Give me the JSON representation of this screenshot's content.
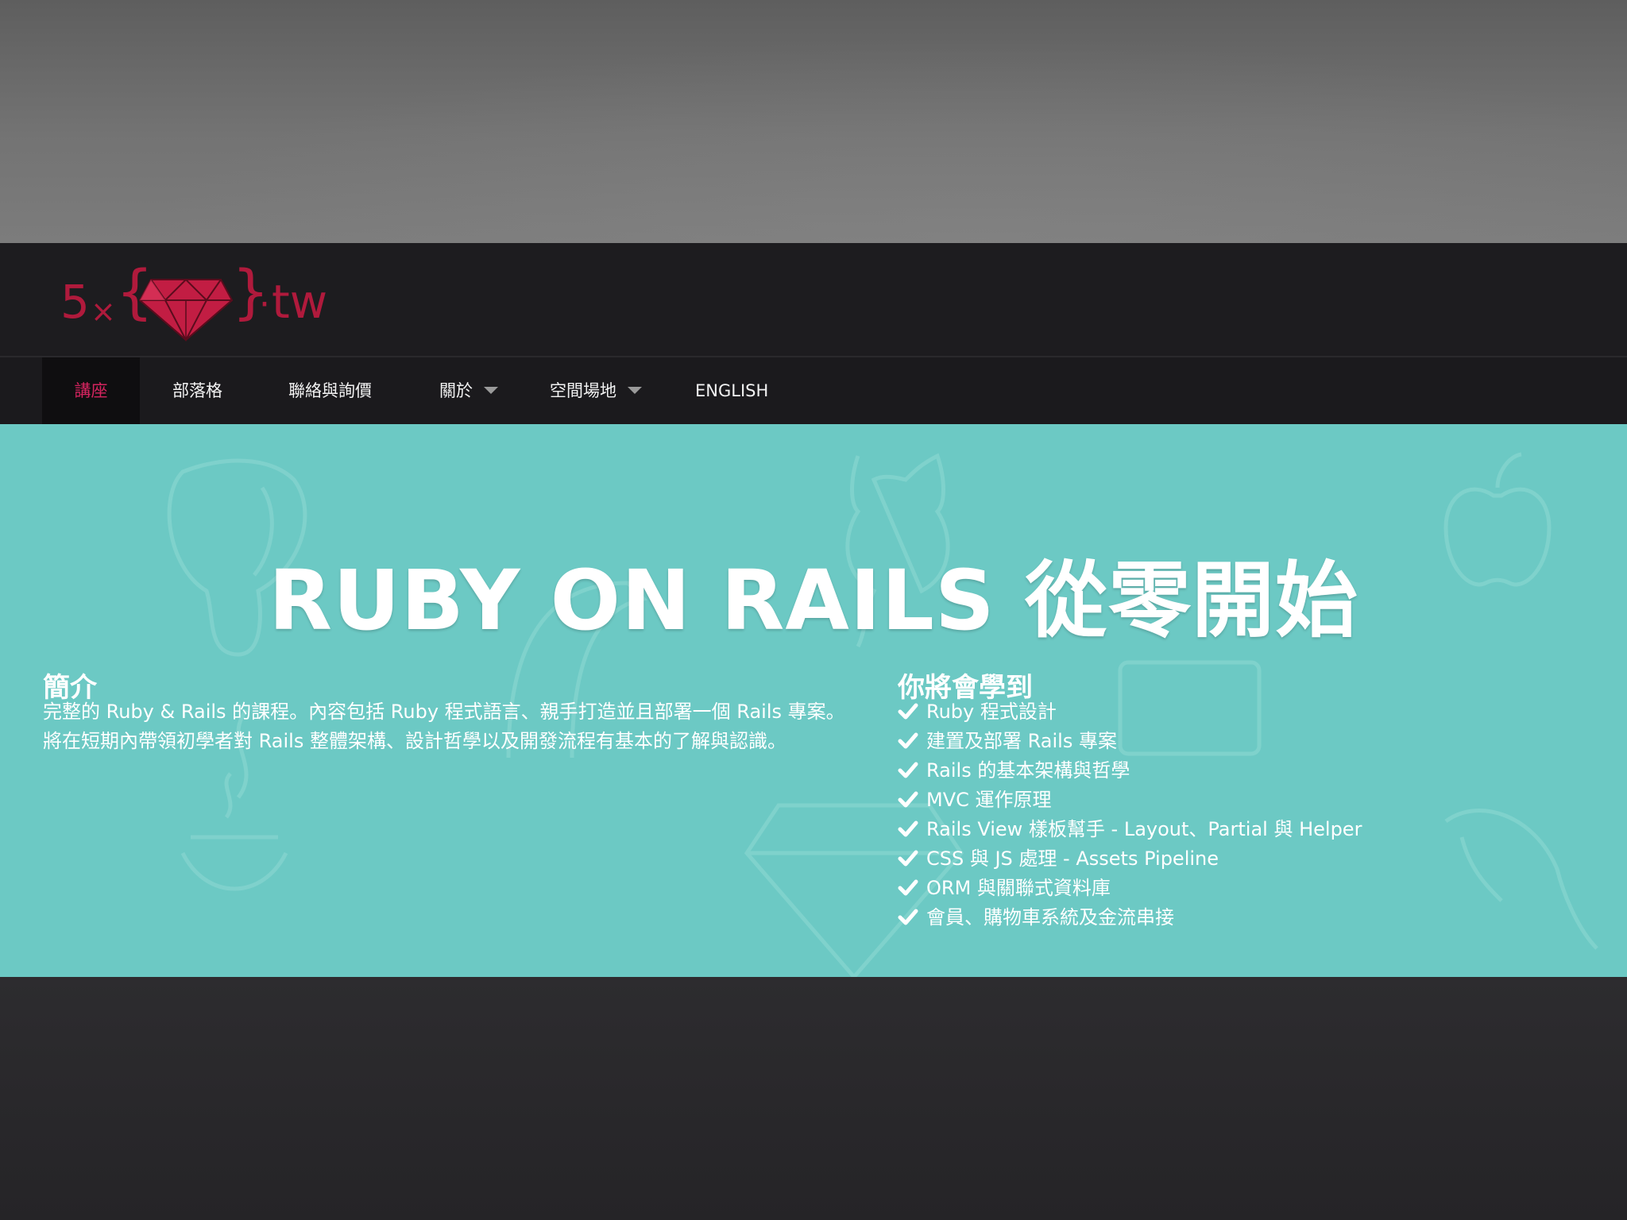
{
  "brand": {
    "logo_parts": [
      "5",
      "×",
      "{",
      "}",
      "·",
      "tw"
    ],
    "logo_color": "#b01a3c"
  },
  "nav": {
    "items": [
      {
        "label": "講座",
        "active": true
      },
      {
        "label": "部落格"
      },
      {
        "label": "聯絡與詢價"
      },
      {
        "label": "關於",
        "has_dropdown": true
      },
      {
        "label": "空間場地",
        "has_dropdown": true
      },
      {
        "label": "ENGLISH"
      }
    ],
    "active_color": "#d4245f"
  },
  "hero": {
    "title": "RUBY ON RAILS 從零開始",
    "background_color": "#6cc9c4",
    "intro": {
      "heading": "簡介",
      "text": "完整的 Ruby & Rails 的課程。內容包括 Ruby 程式語言、親手打造並且部署一個 Rails 專案。將在短期內帶領初學者對 Rails 整體架構、設計哲學以及開發流程有基本的了解與認識。"
    },
    "learn": {
      "heading": "你將會學到",
      "check_icon": "check-icon",
      "items": [
        "Ruby 程式設計",
        "建置及部署 Rails 專案",
        "Rails 的基本架構與哲學",
        "MVC 運作原理",
        "Rails View 樣板幫手 - Layout、Partial 與 Helper",
        "CSS 與 JS 處理 - Assets Pipeline",
        "ORM 與關聯式資料庫",
        "會員、購物車系統及金流串接"
      ]
    }
  }
}
